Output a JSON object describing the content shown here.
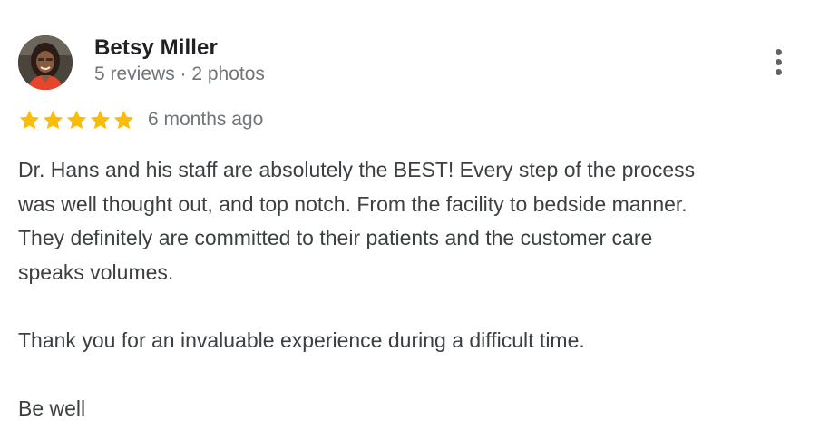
{
  "reviewer": {
    "name": "Betsy Miller",
    "meta": "5 reviews · 2 photos"
  },
  "rating": {
    "stars": 5,
    "max": 5,
    "color": "#fbbc04"
  },
  "review": {
    "time": "6 months ago",
    "lines": [
      "Dr. Hans and his staff are absolutely the BEST! Every step of the process",
      "was well thought out, and top notch. From the facility to bedside manner.",
      "They definitely are committed to their patients and the customer care",
      "speaks volumes.",
      "",
      "Thank you for an invaluable experience during a difficult time.",
      "",
      "Be well"
    ]
  },
  "icons": {
    "avatar": "profile-photo",
    "more": "more-vert-icon",
    "star": "star-icon"
  }
}
